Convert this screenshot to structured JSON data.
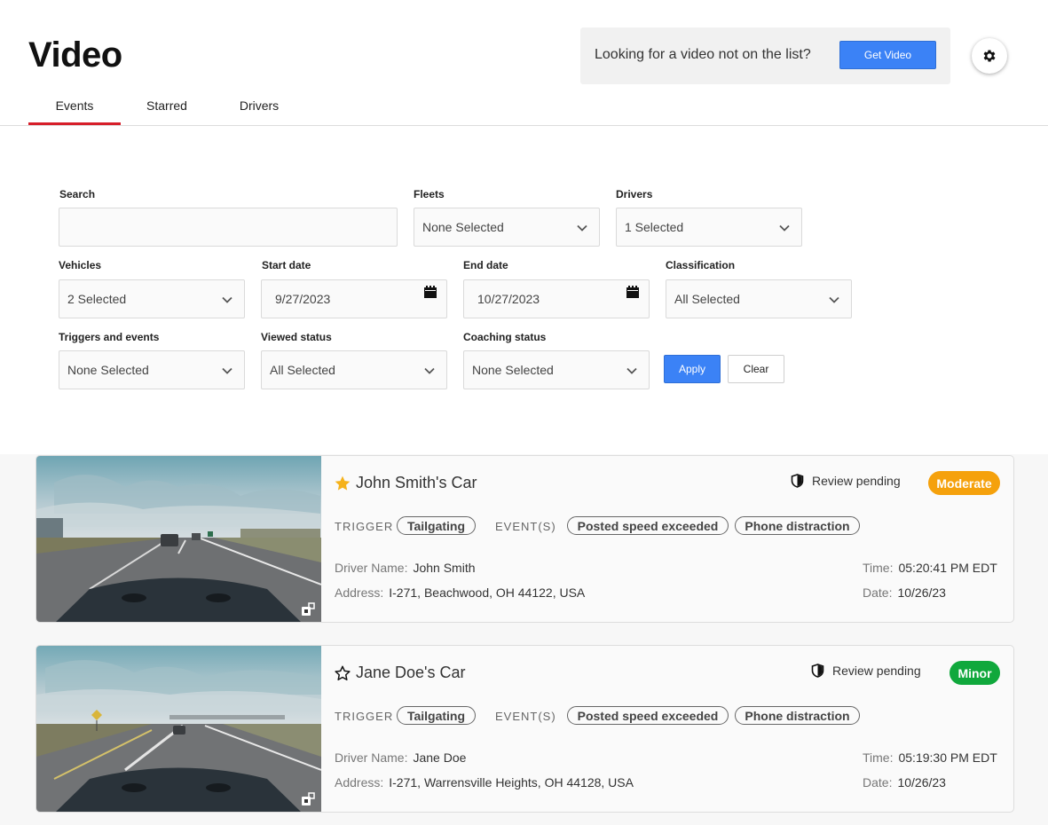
{
  "header": {
    "title": "Video",
    "tabs": [
      {
        "label": "Events",
        "active": true
      },
      {
        "label": "Starred",
        "active": false
      },
      {
        "label": "Drivers",
        "active": false
      }
    ],
    "get_video_prompt": "Looking for a video not on the list?",
    "get_video_button": "Get Video",
    "settings_icon": "gear-icon"
  },
  "filters": {
    "search": {
      "label": "Search",
      "value": "",
      "placeholder": ""
    },
    "fleets": {
      "label": "Fleets",
      "value": "None Selected"
    },
    "drivers": {
      "label": "Drivers",
      "value": "1 Selected"
    },
    "vehicles": {
      "label": "Vehicles",
      "value": "2 Selected"
    },
    "start_date": {
      "label": "Start date",
      "value": "9/27/2023"
    },
    "end_date": {
      "label": "End date",
      "value": "10/27/2023"
    },
    "classification": {
      "label": "Classification",
      "value": "All Selected"
    },
    "triggers": {
      "label": "Triggers and events",
      "value": "None Selected"
    },
    "viewed": {
      "label": "Viewed status",
      "value": "All Selected"
    },
    "coaching": {
      "label": "Coaching status",
      "value": "None Selected"
    },
    "apply_label": "Apply",
    "clear_label": "Clear"
  },
  "labels": {
    "trigger": "TRIGGER",
    "events": "EVENT(S)",
    "driver_name": "Driver Name:",
    "address": "Address:",
    "time": "Time:",
    "date": "Date:"
  },
  "colors": {
    "accent": "#d61e2a",
    "primary": "#3b82f6",
    "moderate": "#f5a10c",
    "minor": "#10a83c",
    "star": "#f5b21b"
  },
  "events": [
    {
      "vehicle": "John Smith's Car",
      "starred": true,
      "review_status": "Review pending",
      "severity": "Moderate",
      "trigger": "Tailgating",
      "event_tags": [
        "Posted speed exceeded",
        "Phone distraction"
      ],
      "driver_name": "John Smith",
      "address": "I-271, Beachwood, OH 44122, USA",
      "time": "05:20:41 PM EDT",
      "date": "10/26/23"
    },
    {
      "vehicle": "Jane Doe's Car",
      "starred": false,
      "review_status": "Review pending",
      "severity": "Minor",
      "trigger": "Tailgating",
      "event_tags": [
        "Posted speed exceeded",
        "Phone distraction"
      ],
      "driver_name": "Jane Doe",
      "address": "I-271, Warrensville Heights, OH 44128, USA",
      "time": "05:19:30 PM EDT",
      "date": "10/26/23"
    }
  ]
}
